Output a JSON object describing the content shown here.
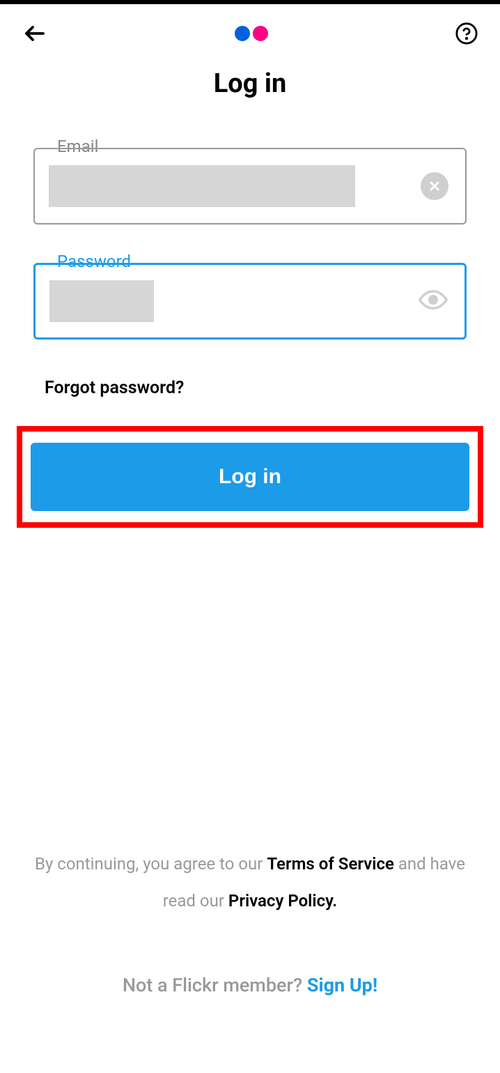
{
  "header": {
    "title": "Log in"
  },
  "fields": {
    "email_label": "Email",
    "password_label": "Password"
  },
  "links": {
    "forgot": "Forgot password?"
  },
  "buttons": {
    "login": "Log in"
  },
  "footer": {
    "agree_prefix": "By continuing, you agree to our ",
    "terms": "Terms of Service",
    "agree_mid": " and have read our ",
    "privacy": "Privacy Policy.",
    "signup_prefix": "Not a Flickr member? ",
    "signup": "Sign Up!"
  }
}
